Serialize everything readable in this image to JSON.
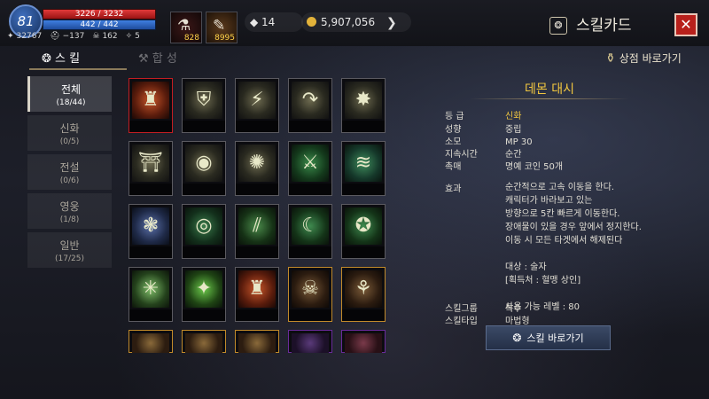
{
  "hud": {
    "level": "81",
    "hp": "3226 / 3232",
    "mp": "442 / 442",
    "stat1": "32767",
    "stat2": "−137",
    "stat3": "162",
    "stat4": "5",
    "slot1_count": "828",
    "slot2_count": "8995",
    "currency1": "14",
    "gold": "5,907,056"
  },
  "window": {
    "title": "스킬카드",
    "close": "✕"
  },
  "tabs": {
    "skill": "스 킬",
    "synth": "합 성",
    "shop": "상점 바로가기"
  },
  "categories": [
    {
      "label": "전체",
      "count": "(18/44)"
    },
    {
      "label": "신화",
      "count": "(0/5)"
    },
    {
      "label": "전설",
      "count": "(0/6)"
    },
    {
      "label": "영웅",
      "count": "(1/8)"
    },
    {
      "label": "일반",
      "count": "(17/25)"
    }
  ],
  "detail": {
    "name": "데몬 대시",
    "rows": [
      {
        "k": "등 급",
        "v": "신화"
      },
      {
        "k": "성향",
        "v": "중립"
      },
      {
        "k": "소모",
        "v": "MP 30"
      },
      {
        "k": "지속시간",
        "v": "순간"
      },
      {
        "k": "촉매",
        "v": "명예 코인 50개"
      }
    ],
    "effect_label": "효과",
    "effect_text": "순간적으로 고속 이동을 한다.\n캐릭터가 바라보고 있는\n방향으로 5칸 빠르게 이동한다.\n장애물이 있을 경우 앞에서 정지한다.\n이동 시 모든 타겟에서 해제된다\n\n대상 : 술자\n[획득처 : 혈맹 상인]\n\n사용 가능 레벨 : 80",
    "group_label": "스킬그룹",
    "group_value": "특수",
    "type_label": "스킬타입",
    "type_value": "마법형",
    "button": "스킬 바로가기"
  }
}
